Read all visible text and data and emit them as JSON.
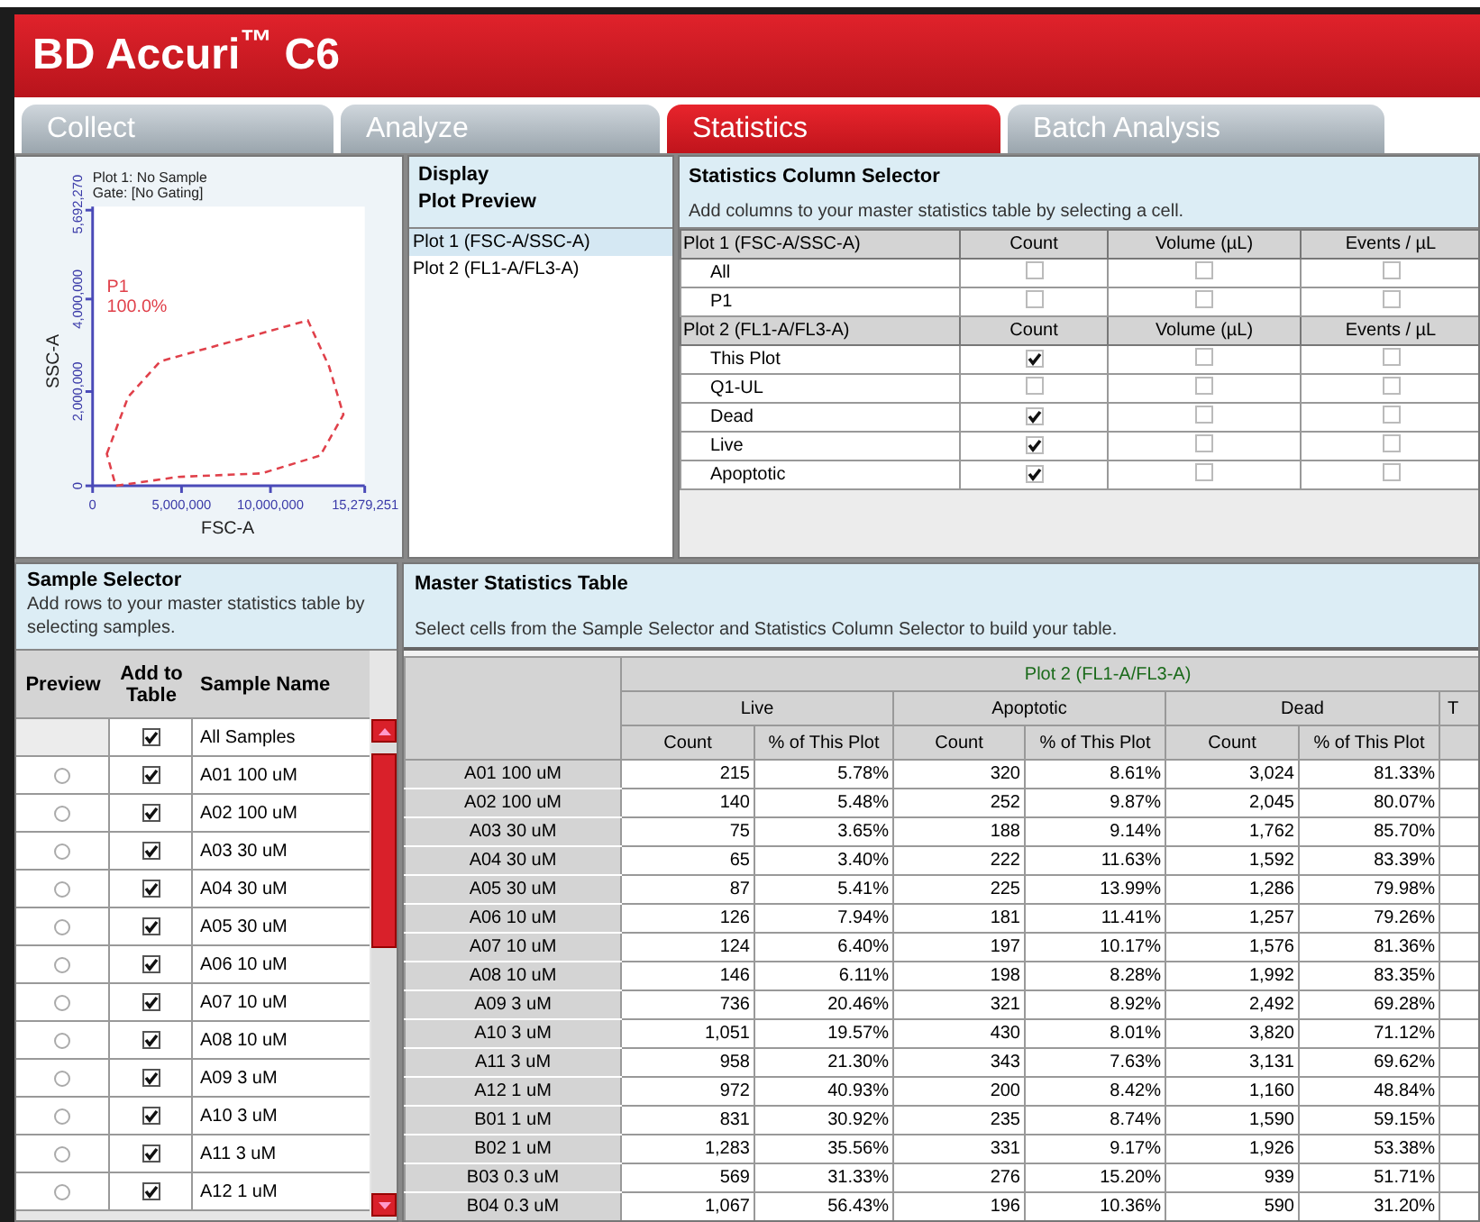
{
  "app_title": "BD Accuri$^{™}$ C6",
  "tabs": [
    {
      "label": "Collect",
      "selected": false
    },
    {
      "label": "Analyze",
      "selected": false
    },
    {
      "label": "Statistics",
      "selected": true
    },
    {
      "label": "Batch Analysis",
      "selected": false
    }
  ],
  "plot": {
    "title": "Plot 1: No Sample",
    "gate": "Gate: [No Gating]",
    "xlabel": "FSC-A",
    "ylabel": "SSC-A",
    "xticks": [
      "0",
      "5,000,000",
      "10,000,000",
      "15,279,251"
    ],
    "yticks": [
      "0",
      "2,000,000",
      "4,000,000",
      "5,692,270"
    ],
    "gate_name": "P1",
    "gate_percent": "100.0%"
  },
  "display": {
    "title": "Display",
    "subtitle": "Plot Preview",
    "items": [
      {
        "label": "Plot 1 (FSC-A/SSC-A)",
        "selected": true
      },
      {
        "label": "Plot 2 (FL1-A/FL3-A)",
        "selected": false
      }
    ]
  },
  "column_selector": {
    "title": "Statistics Column Selector",
    "description": "Add columns to your master statistics table by selecting a cell.",
    "groups": [
      {
        "label": "Plot 1 (FSC-A/SSC-A)",
        "columns": [
          "Count",
          "Volume (µL)",
          "Events / µL"
        ],
        "rows": [
          {
            "label": "All",
            "checks": [
              false,
              false,
              false
            ]
          },
          {
            "label": "P1",
            "checks": [
              false,
              false,
              false
            ]
          }
        ]
      },
      {
        "label": "Plot 2 (FL1-A/FL3-A)",
        "columns": [
          "Count",
          "Volume (µL)",
          "Events / µL"
        ],
        "rows": [
          {
            "label": "This Plot",
            "checks": [
              true,
              false,
              false
            ]
          },
          {
            "label": "Q1-UL",
            "checks": [
              false,
              false,
              false
            ]
          },
          {
            "label": "Dead",
            "checks": [
              true,
              false,
              false
            ]
          },
          {
            "label": "Live",
            "checks": [
              true,
              false,
              false
            ]
          },
          {
            "label": "Apoptotic",
            "checks": [
              true,
              false,
              false
            ]
          }
        ]
      }
    ]
  },
  "sample_selector": {
    "title": "Sample Selector",
    "description": "Add rows to your master statistics table by selecting samples.",
    "columns": [
      "Preview",
      "Add to Table",
      "Sample Name"
    ],
    "rows": [
      {
        "kind": "all",
        "name": "All Samples",
        "added": true
      },
      {
        "kind": "sample",
        "name": "A01 100 uM",
        "added": true,
        "preview": false
      },
      {
        "kind": "sample",
        "name": "A02 100 uM",
        "added": true,
        "preview": false
      },
      {
        "kind": "sample",
        "name": "A03 30 uM",
        "added": true,
        "preview": false
      },
      {
        "kind": "sample",
        "name": "A04 30 uM",
        "added": true,
        "preview": false
      },
      {
        "kind": "sample",
        "name": "A05 30 uM",
        "added": true,
        "preview": false
      },
      {
        "kind": "sample",
        "name": "A06 10 uM",
        "added": true,
        "preview": false
      },
      {
        "kind": "sample",
        "name": "A07 10 uM",
        "added": true,
        "preview": false
      },
      {
        "kind": "sample",
        "name": "A08 10 uM",
        "added": true,
        "preview": false
      },
      {
        "kind": "sample",
        "name": "A09 3 uM",
        "added": true,
        "preview": false
      },
      {
        "kind": "sample",
        "name": "A10 3 uM",
        "added": true,
        "preview": false
      },
      {
        "kind": "sample",
        "name": "A11 3 uM",
        "added": true,
        "preview": false
      },
      {
        "kind": "sample",
        "name": "A12 1 uM",
        "added": true,
        "preview": false
      }
    ]
  },
  "master_table": {
    "title": "Master Statistics Table",
    "description": "Select cells from the Sample Selector and Statistics Column Selector to build your table.",
    "plot_header": "Plot 2 (FL1-A/FL3-A)",
    "groups": [
      "Live",
      "Apoptotic",
      "Dead",
      "T"
    ],
    "columns": [
      "Count",
      "% of This Plot",
      "Count",
      "% of This Plot",
      "Count",
      "% of This Plot"
    ],
    "rows": [
      {
        "name": "A01 100 uM",
        "values": [
          "215",
          "5.78%",
          "320",
          "8.61%",
          "3,024",
          "81.33%"
        ]
      },
      {
        "name": "A02 100 uM",
        "values": [
          "140",
          "5.48%",
          "252",
          "9.87%",
          "2,045",
          "80.07%"
        ]
      },
      {
        "name": "A03 30 uM",
        "values": [
          "75",
          "3.65%",
          "188",
          "9.14%",
          "1,762",
          "85.70%"
        ]
      },
      {
        "name": "A04 30 uM",
        "values": [
          "65",
          "3.40%",
          "222",
          "11.63%",
          "1,592",
          "83.39%"
        ]
      },
      {
        "name": "A05 30 uM",
        "values": [
          "87",
          "5.41%",
          "225",
          "13.99%",
          "1,286",
          "79.98%"
        ]
      },
      {
        "name": "A06 10 uM",
        "values": [
          "126",
          "7.94%",
          "181",
          "11.41%",
          "1,257",
          "79.26%"
        ]
      },
      {
        "name": "A07 10 uM",
        "values": [
          "124",
          "6.40%",
          "197",
          "10.17%",
          "1,576",
          "81.36%"
        ]
      },
      {
        "name": "A08 10 uM",
        "values": [
          "146",
          "6.11%",
          "198",
          "8.28%",
          "1,992",
          "83.35%"
        ]
      },
      {
        "name": "A09 3 uM",
        "values": [
          "736",
          "20.46%",
          "321",
          "8.92%",
          "2,492",
          "69.28%"
        ]
      },
      {
        "name": "A10 3 uM",
        "values": [
          "1,051",
          "19.57%",
          "430",
          "8.01%",
          "3,820",
          "71.12%"
        ]
      },
      {
        "name": "A11 3 uM",
        "values": [
          "958",
          "21.30%",
          "343",
          "7.63%",
          "3,131",
          "69.62%"
        ]
      },
      {
        "name": "A12 1 uM",
        "values": [
          "972",
          "40.93%",
          "200",
          "8.42%",
          "1,160",
          "48.84%"
        ]
      },
      {
        "name": "B01 1 uM",
        "values": [
          "831",
          "30.92%",
          "235",
          "8.74%",
          "1,590",
          "59.15%"
        ]
      },
      {
        "name": "B02 1 uM",
        "values": [
          "1,283",
          "35.56%",
          "331",
          "9.17%",
          "1,926",
          "53.38%"
        ]
      },
      {
        "name": "B03 0.3 uM",
        "values": [
          "569",
          "31.33%",
          "276",
          "15.20%",
          "939",
          "51.71%"
        ]
      },
      {
        "name": "B04 0.3 uM",
        "values": [
          "1,067",
          "56.43%",
          "196",
          "10.36%",
          "590",
          "31.20%"
        ]
      }
    ]
  }
}
